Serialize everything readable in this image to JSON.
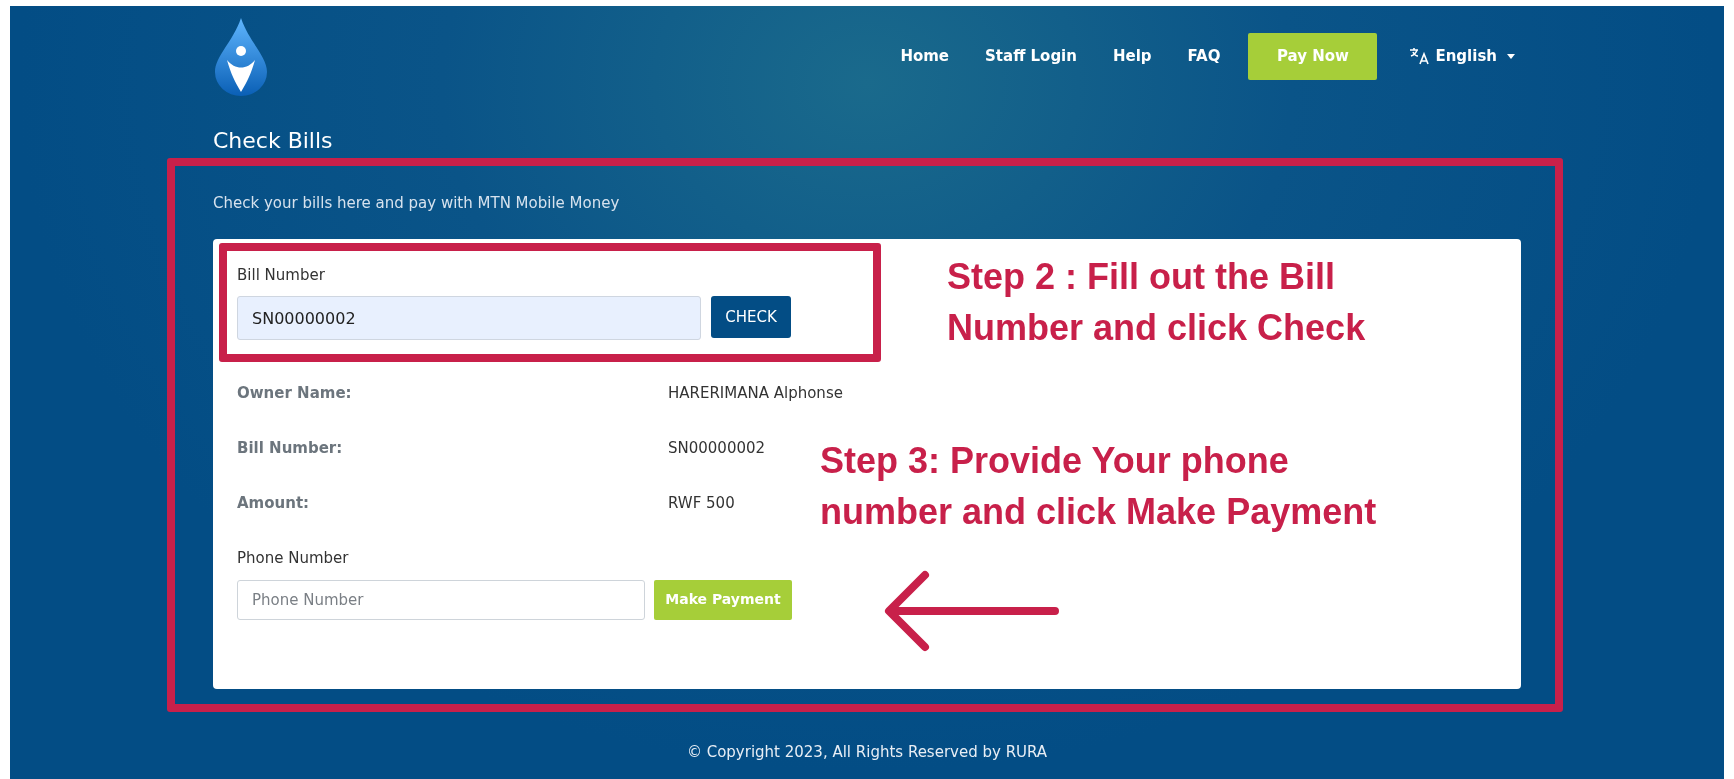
{
  "nav": {
    "items": [
      {
        "label": "Home"
      },
      {
        "label": "Staff Login"
      },
      {
        "label": "Help"
      },
      {
        "label": "FAQ"
      }
    ],
    "pay_button": "Pay Now",
    "language": "English"
  },
  "page_title": "Check Bills",
  "subtitle": "Check your bills here and pay with MTN Mobile Money",
  "bill_form": {
    "label": "Bill Number",
    "value": "SN00000002",
    "button": "CHECK"
  },
  "details": [
    {
      "label": "Owner Name:",
      "value": "HARERIMANA Alphonse"
    },
    {
      "label": "Bill Number:",
      "value": "SN00000002"
    },
    {
      "label": "Amount:",
      "value": "RWF 500"
    }
  ],
  "phone_form": {
    "label": "Phone Number",
    "placeholder": "Phone Number",
    "button": "Make Payment"
  },
  "annotations": [
    {
      "kind": "note",
      "text": "Step 2 : Fill out the Bill Number and click Check"
    },
    {
      "kind": "note",
      "text": "Step 3: Provide Your phone number and click Make Payment"
    },
    {
      "kind": "arrow"
    }
  ],
  "footer": "© Copyright 2023, All Rights Reserved by RURA"
}
